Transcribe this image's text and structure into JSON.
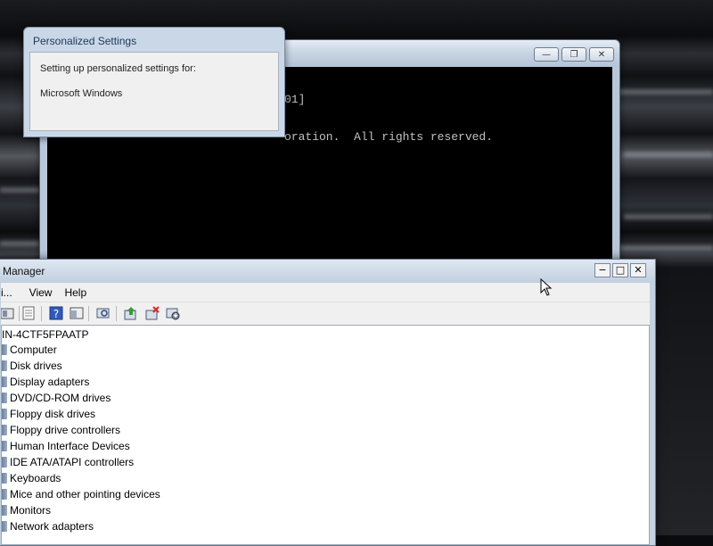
{
  "colors": {
    "console_bg": "#000000",
    "console_text": "#c0c0c0",
    "dialog_frame": "#c9d7e7",
    "window_frame": "#c3d1e0"
  },
  "cmd": {
    "console_lines": [
      "01]",
      "oration.  All rights reserved."
    ],
    "controls": {
      "minimize_icon": "minimize-icon",
      "restore_icon": "restore-icon",
      "close_icon": "close-icon"
    }
  },
  "personalized_settings": {
    "title": "Personalized Settings",
    "line1": "Setting up personalized settings for:",
    "line2": "Microsoft Windows"
  },
  "device_manager": {
    "title": "Manager",
    "menus": [
      "i...",
      "View",
      "Help"
    ],
    "toolbar_icons": [
      "back-icon",
      "properties-icon",
      "help-icon",
      "view-icon",
      "scan-hardware-icon",
      "update-driver-icon",
      "uninstall-icon",
      "disable-icon"
    ],
    "tree_root": "IN-4CTF5FPAATP",
    "tree_items": [
      "Computer",
      "Disk drives",
      "Display adapters",
      "DVD/CD-ROM drives",
      "Floppy disk drives",
      "Floppy drive controllers",
      "Human Interface Devices",
      "IDE ATA/ATAPI controllers",
      "Keyboards",
      "Mice and other pointing devices",
      "Monitors",
      "Network adapters"
    ]
  }
}
